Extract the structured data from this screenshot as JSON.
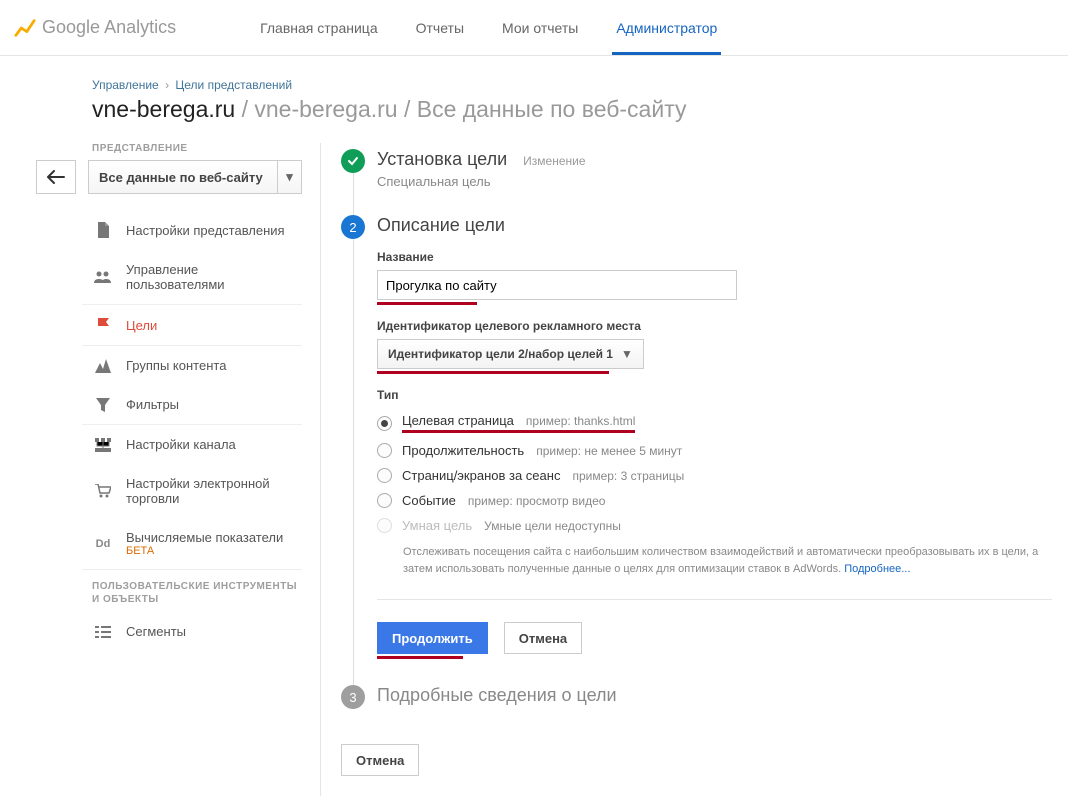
{
  "header": {
    "brand": "Google",
    "product": "Analytics",
    "nav": [
      {
        "label": "Главная страница"
      },
      {
        "label": "Отчеты"
      },
      {
        "label": "Мои отчеты"
      },
      {
        "label": "Администратор",
        "active": true
      }
    ]
  },
  "breadcrumb": {
    "a": "Управление",
    "b": "Цели представлений"
  },
  "page_title": {
    "black": "vne-berega.ru",
    "grey": " / vne-berega.ru / Все данные по веб-сайту"
  },
  "leftcol": {
    "section_label": "ПРЕДСТАВЛЕНИЕ",
    "view_name": "Все данные по веб-сайту",
    "menu": {
      "settings": "Настройки представления",
      "users": "Управление пользователями",
      "goals": "Цели",
      "content": "Группы контента",
      "filters": "Фильтры",
      "channel": "Настройки канала",
      "ecommerce": "Настройки электронной торговли",
      "calc": "Вычисляемые показатели",
      "calc_sub": "БЕТА",
      "segments": "Сегменты"
    },
    "tools_label": "ПОЛЬЗОВАТЕЛЬСКИЕ ИНСТРУМЕНТЫ И ОБЪЕКТЫ"
  },
  "step1": {
    "title": "Установка цели",
    "change": "Изменение",
    "sub": "Специальная цель"
  },
  "step2": {
    "title": "Описание цели",
    "name_label": "Название",
    "name_value": "Прогулка по сайту",
    "slot_label": "Идентификатор целевого рекламного места",
    "slot_value": "Идентификатор цели 2/набор целей 1",
    "type_label": "Тип",
    "radios": {
      "dest": {
        "label": "Целевая страница",
        "hint": "пример: thanks.html"
      },
      "dur": {
        "label": "Продолжительность",
        "hint": "пример: не менее 5 минут"
      },
      "pps": {
        "label": "Страниц/экранов за сеанс",
        "hint": "пример: 3 страницы"
      },
      "event": {
        "label": "Событие",
        "hint": "пример: просмотр видео"
      },
      "smart": {
        "label": "Умная цель",
        "hint": "Умные цели недоступны",
        "desc": "Отслеживать посещения сайта с наибольшим количеством взаимодействий и автоматически преобразовывать их в цели, а затем использовать полученные данные о целях для оптимизации ставок в AdWords.",
        "more": "Подробнее..."
      }
    },
    "continue": "Продолжить",
    "cancel": "Отмена"
  },
  "step3": {
    "num": "3",
    "title": "Подробные сведения о цели"
  },
  "main_cancel": "Отмена"
}
